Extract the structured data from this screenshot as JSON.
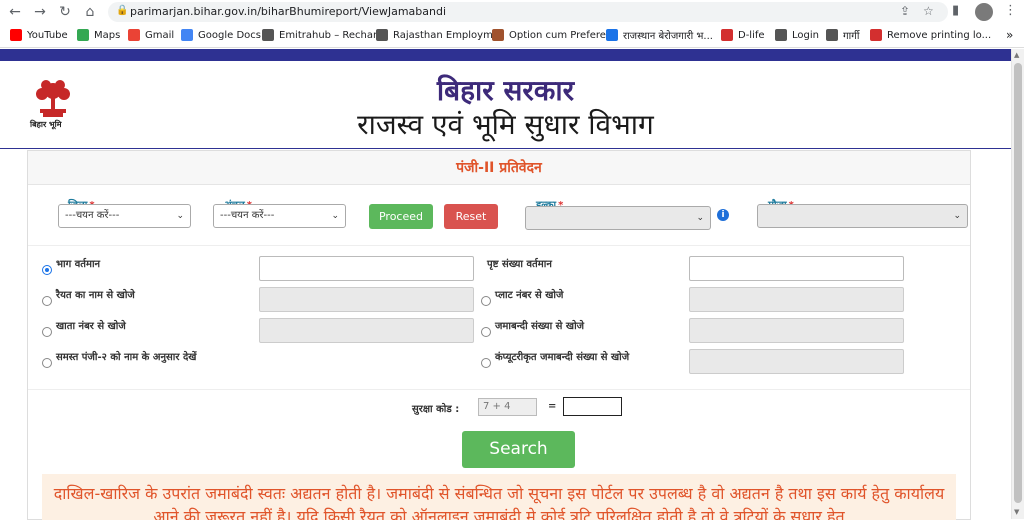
{
  "browser": {
    "url": "parimarjan.bihar.gov.in/biharBhumireport/ViewJamabandi",
    "bookmarks": [
      {
        "label": "YouTube",
        "icon": "youtube-icon",
        "color": "#ff0000"
      },
      {
        "label": "Maps",
        "icon": "maps-icon",
        "color": "#34a853"
      },
      {
        "label": "Gmail",
        "icon": "gmail-icon",
        "color": "#ea4335"
      },
      {
        "label": "Google Docs",
        "icon": "docs-icon",
        "color": "#4285f4"
      },
      {
        "label": "Emitrahub – Rechar...",
        "icon": "globe-icon",
        "color": "#555555"
      },
      {
        "label": "Rajasthan Employm...",
        "icon": "globe-icon",
        "color": "#555555"
      },
      {
        "label": "Option cum Prefere...",
        "icon": "emblem-icon",
        "color": "#a0522d"
      },
      {
        "label": "राजस्थान बेरोजगारी भ...",
        "icon": "pin-icon",
        "color": "#1a73e8"
      },
      {
        "label": "D-life",
        "icon": "dlife-icon",
        "color": "#d32f2f"
      },
      {
        "label": "Login",
        "icon": "diamond-icon",
        "color": "#555555"
      },
      {
        "label": "गार्गी",
        "icon": "globe-icon",
        "color": "#555555"
      },
      {
        "label": "Remove printing lo...",
        "icon": "pdf-icon",
        "color": "#d32f2f"
      }
    ]
  },
  "header": {
    "logo_text": "बिहार भूमि",
    "title_line1": "बिहार सरकार",
    "title_line2": "राजस्व एवं भूमि सुधार विभाग"
  },
  "panel": {
    "title": "पंजी-II प्रतिवेदन",
    "district_label": "जिला",
    "district_value": "---चयन करें---",
    "circle_label": "अंचल",
    "circle_value": "---चयन करें---",
    "proceed_label": "Proceed",
    "reset_label": "Reset",
    "halka_label": "हल्का",
    "mauza_label": "मौजा",
    "required_mark": "*"
  },
  "options": {
    "bhag": "भाग वर्तमान",
    "prishth": "पृष्ट संख्या वर्तमान",
    "raiyat": "रैयत का नाम से खोजे",
    "plot": "प्लाट नंबर से खोजे",
    "khata": "खाता नंबर से खोजे",
    "jamabandi": "जमाबन्दी संख्या से खोजे",
    "samast": "समस्त पंजी-२ को नाम के अनुसार देखें",
    "computer": "कंप्यूटरीकृत जमाबन्दी संख्या से खोजे",
    "selected": "bhag"
  },
  "captcha": {
    "label": "सुरक्षा कोड :",
    "question": "7 + 4",
    "equals": "="
  },
  "search_label": "Search",
  "notice": "दाखिल-खारिज के उपरांत जमाबंदी स्वतः अद्यतन होती है। जमाबंदी से संबन्धित जो सूचना इस पोर्टल पर उपलब्ध है वो अद्यतन है तथा इस कार्य हेतु कार्यालय आने की जरूरत नहीं है। यदि किसी रैयत को ऑनलाइन जमाबंदी मे कोई त्रुटि परिलक्षित होती है तो वे त्रुटियों के सुधार हेतु"
}
